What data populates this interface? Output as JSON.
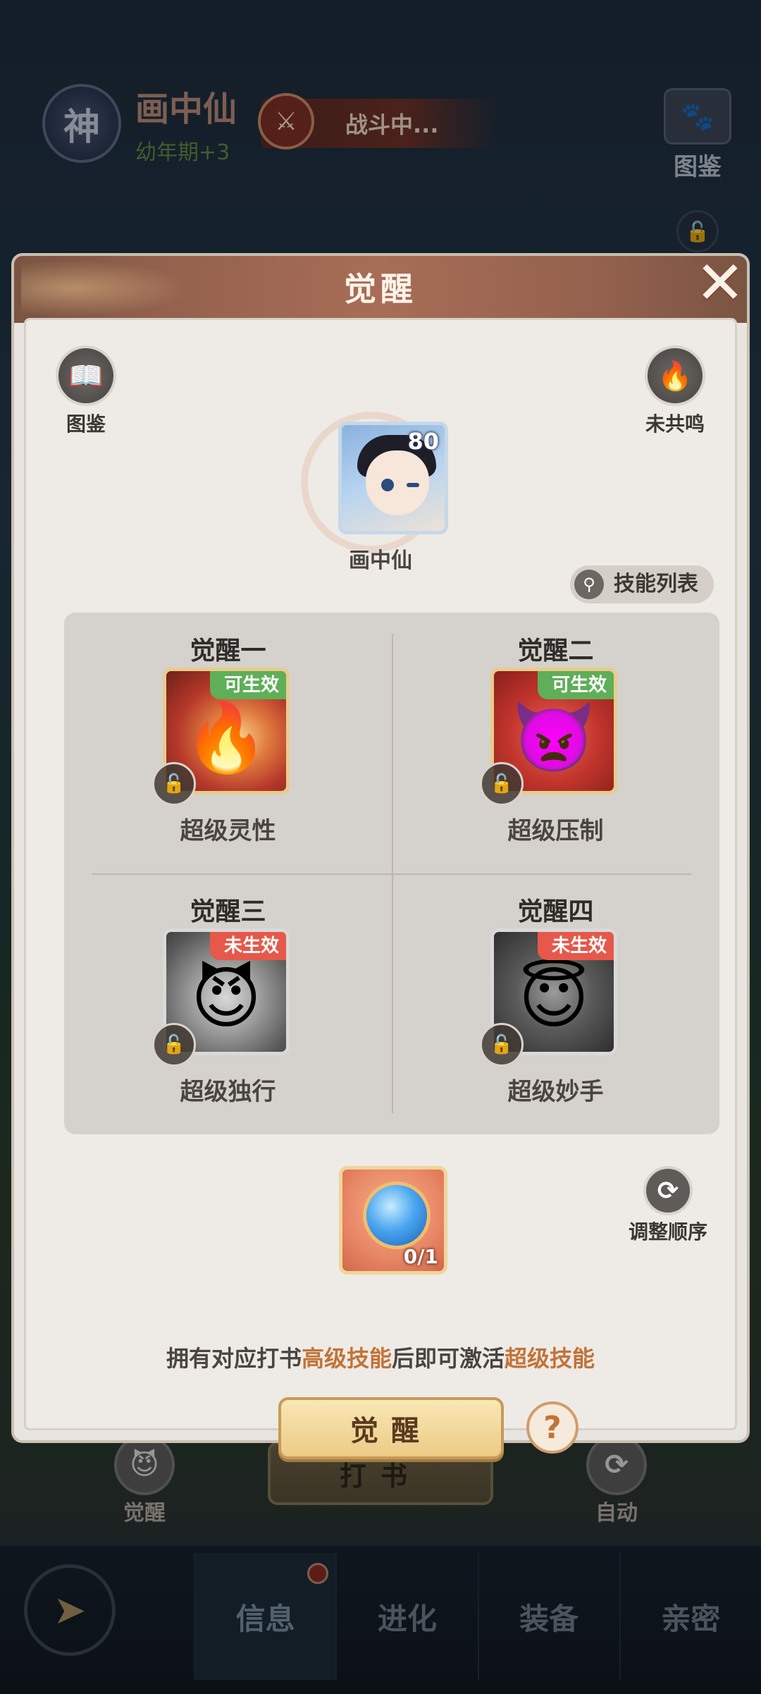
{
  "background": {
    "seal_char": "神",
    "pet_name": "画中仙",
    "pet_stage": "幼年期+3",
    "battle_status": "战斗中...",
    "book_label": "图鉴",
    "bottom_awaken": "觉醒",
    "bottom_dashu": "打书",
    "bottom_auto": "自动",
    "nav_tabs": [
      {
        "label": "信息",
        "active": true,
        "dot": true
      },
      {
        "label": "进化"
      },
      {
        "label": "装备"
      },
      {
        "label": "亲密"
      }
    ]
  },
  "dialog": {
    "title": "觉醒",
    "left_btn_label": "图鉴",
    "right_btn_label": "未共鸣",
    "pet": {
      "name": "画中仙",
      "level": "80"
    },
    "skill_list_label": "技能列表",
    "awakenings": [
      {
        "title": "觉醒一",
        "badge": "可生效",
        "status": "ok",
        "skill": "超级灵性"
      },
      {
        "title": "觉醒二",
        "badge": "可生效",
        "status": "ok",
        "skill": "超级压制"
      },
      {
        "title": "觉醒三",
        "badge": "未生效",
        "status": "no",
        "skill": "超级独行"
      },
      {
        "title": "觉醒四",
        "badge": "未生效",
        "status": "no",
        "skill": "超级妙手"
      }
    ],
    "item_count": "0/1",
    "reorder_label": "调整顺序",
    "hint": {
      "part1": "拥有对应打书",
      "highlight1": "高级技能",
      "part2": "后即可激活",
      "highlight2": "超级技能"
    },
    "awaken_button": "觉醒",
    "help_symbol": "?"
  },
  "colors": {
    "badge_ok": "#5fae58",
    "badge_no": "#e6584a",
    "highlight": "#c27338",
    "header": "#a86d56"
  }
}
